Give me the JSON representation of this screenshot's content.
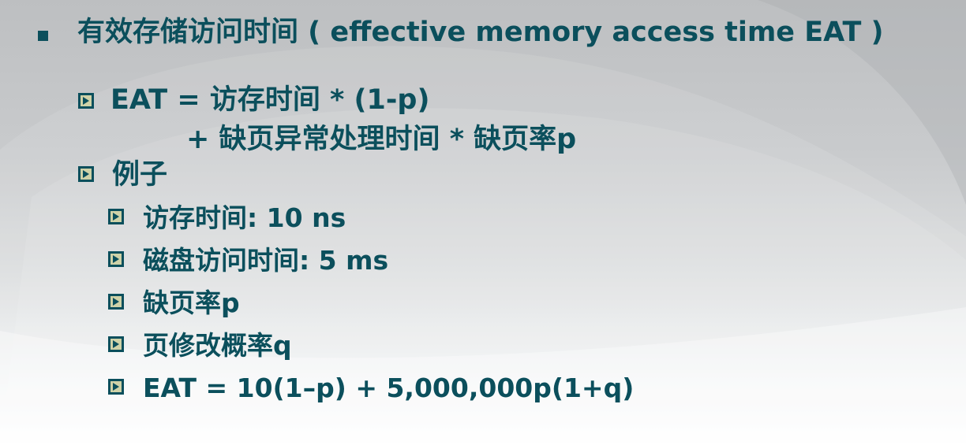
{
  "title": "有效存储访问时间 ( effective memory access time EAT )",
  "bullets": [
    {
      "line1": "EAT = 访存时间 * (1-p)",
      "line2": "+ 缺页异常处理时间 * 缺页率p"
    },
    {
      "label": "例子",
      "items": [
        "访存时间: 10 ns",
        "磁盘访问时间: 5 ms",
        "缺页率p",
        "页修改概率q",
        "EAT = 10(1–p) + 5,000,000p(1+q)"
      ]
    }
  ],
  "colors": {
    "text": "#0b4f5c",
    "bullet_fill": "#cfd2a8",
    "background_top": "#bdbfc1",
    "background_bottom": "#ffffff"
  }
}
